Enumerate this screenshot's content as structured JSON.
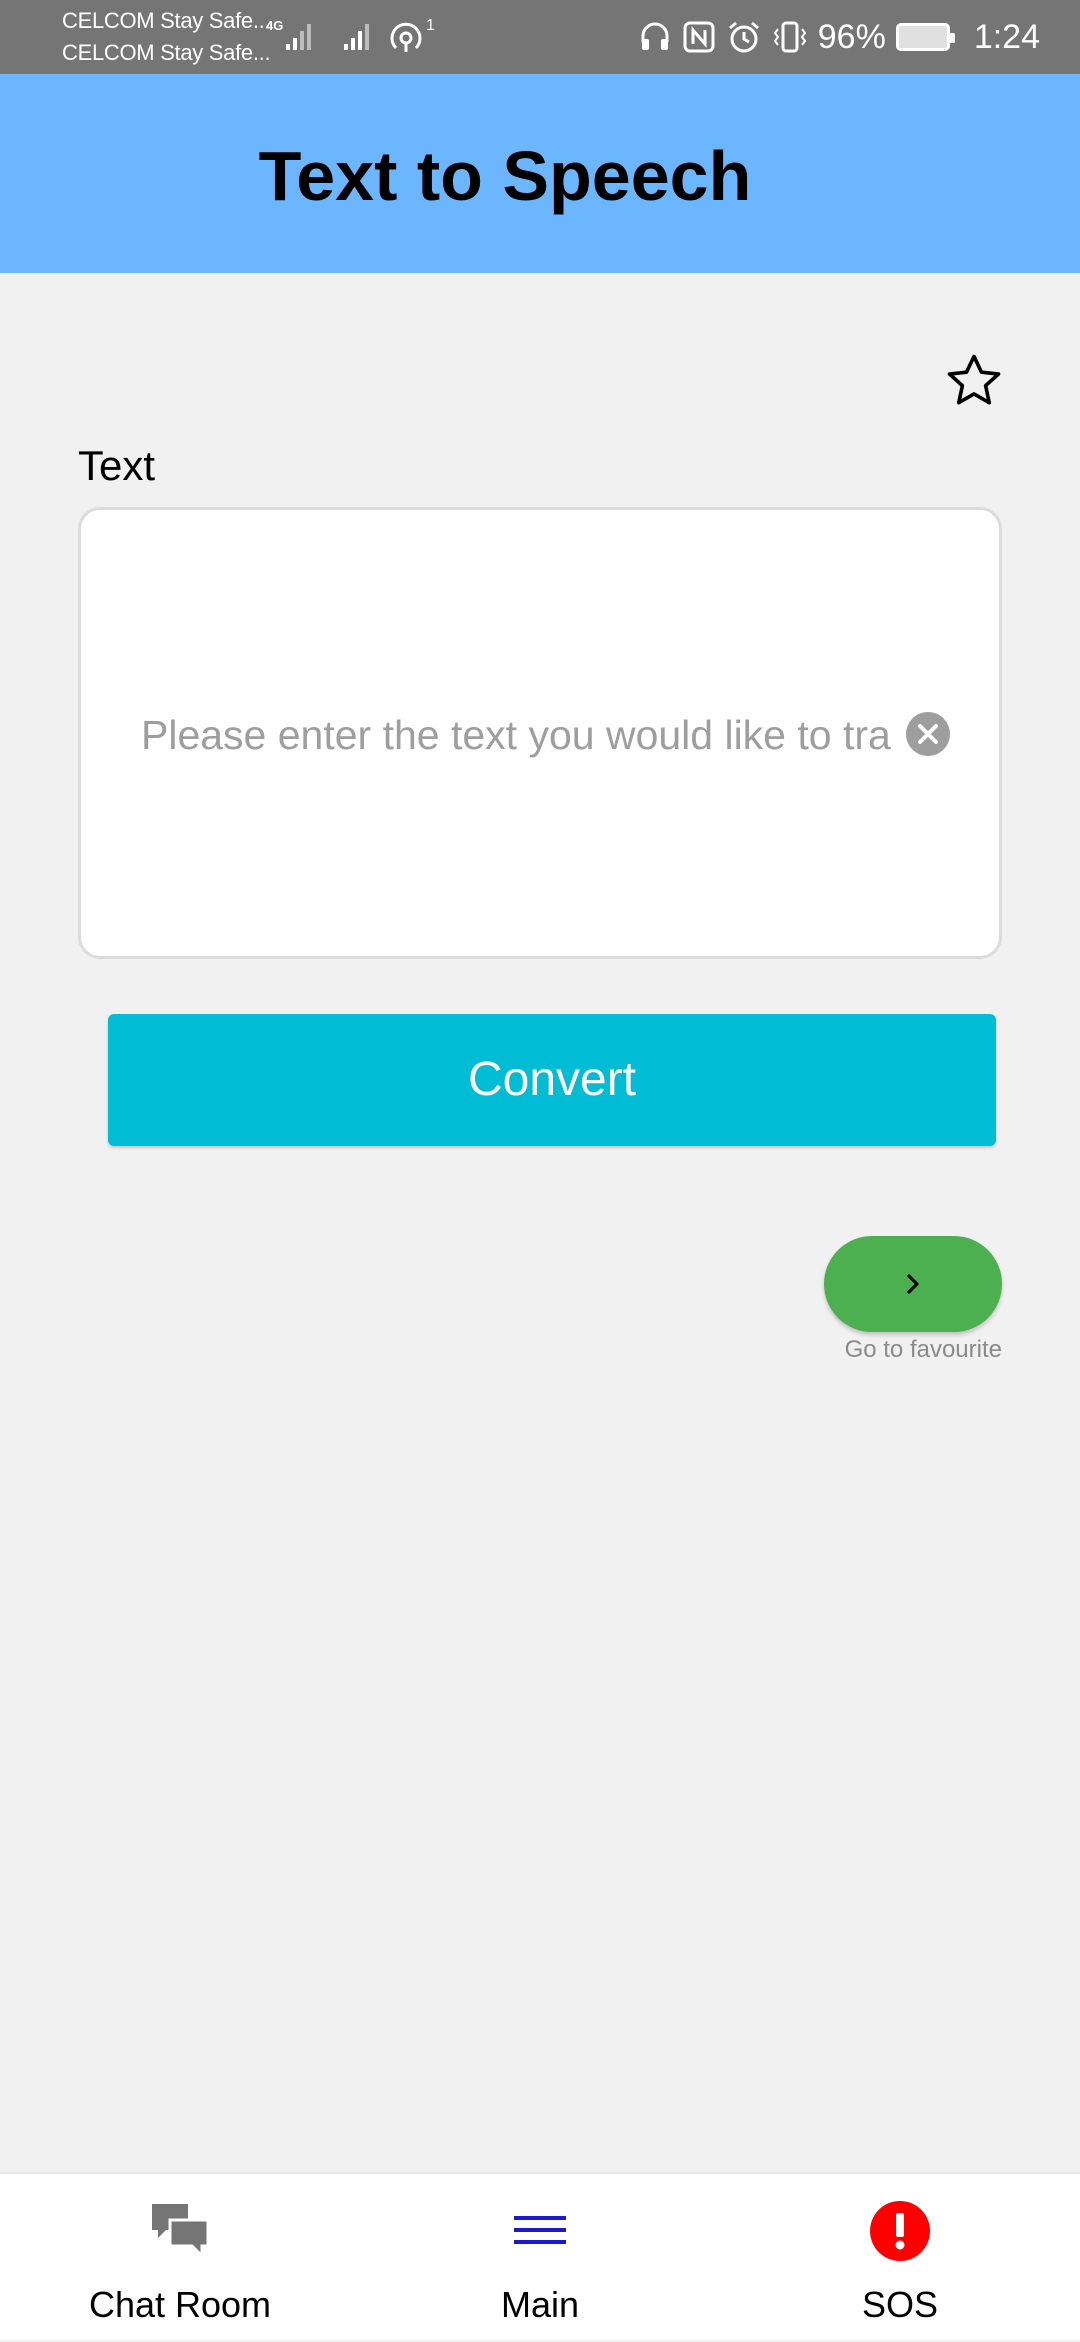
{
  "status_bar": {
    "carrier_1": "CELCOM Stay Safe...",
    "carrier_2": "CELCOM Stay Safe...",
    "network_type": "4G",
    "hotspot_count": "1",
    "battery": "96%",
    "time": "1:24"
  },
  "header": {
    "title": "Text to Speech",
    "background_color": "#6cb6ff"
  },
  "favourite_star": {
    "icon": "star-outline-icon",
    "filled": false
  },
  "text_field": {
    "label": "Text",
    "value": "",
    "placeholder": "Please enter the text you would like to tra",
    "clear_icon": "clear-icon"
  },
  "convert_button": {
    "label": "Convert",
    "color": "#00bcd4"
  },
  "go_to_favourite": {
    "icon": "chevron-right-icon",
    "caption": "Go to favourite",
    "color": "#4caf50"
  },
  "bottom_nav": {
    "items": [
      {
        "label": "Chat Room",
        "icon": "chat-bubbles-icon",
        "active": false
      },
      {
        "label": "Main",
        "icon": "menu-icon",
        "active": true
      },
      {
        "label": "SOS",
        "icon": "alert-icon",
        "active": false
      }
    ],
    "active_color": "#1a1acc",
    "sos_color": "#ff0000"
  }
}
